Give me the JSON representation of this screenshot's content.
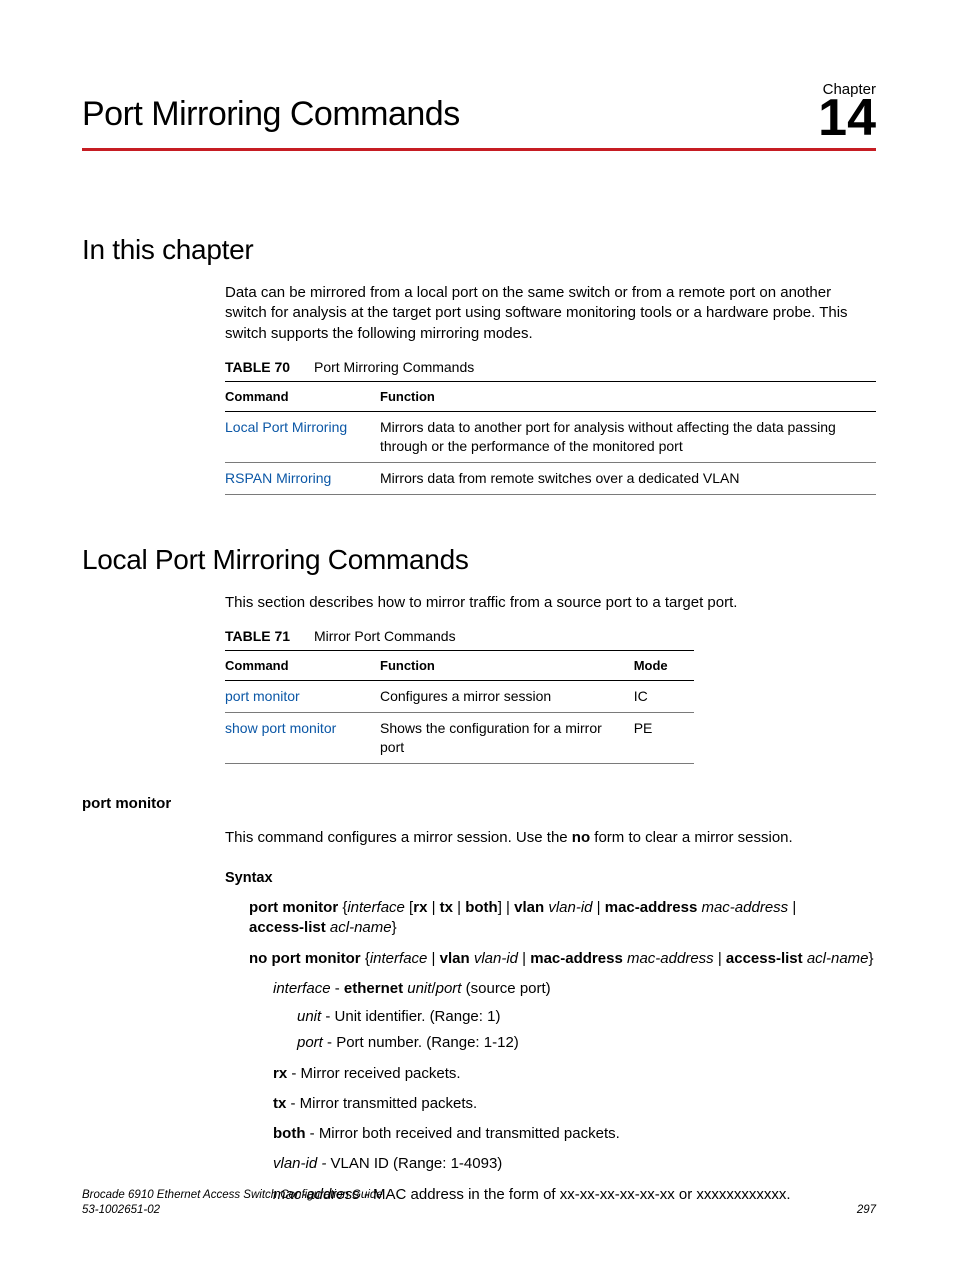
{
  "chapter": {
    "label": "Chapter",
    "number": "14",
    "title": "Port Mirroring Commands"
  },
  "s1": {
    "heading": "In this chapter",
    "intro": "Data can be mirrored from a local port on the same switch or from a remote port on another switch for analysis at the target port using software monitoring tools or a hardware probe. This switch supports the following mirroring modes.",
    "table70": {
      "num": "TABLE 70",
      "caption": "Port Mirroring Commands",
      "h1": "Command",
      "h2": "Function",
      "r1c1": "Local Port Mirroring",
      "r1c2": "Mirrors data to another port for analysis without affecting the data passing through or the performance of the monitored port",
      "r2c1": "RSPAN Mirroring",
      "r2c2": "Mirrors data from remote switches over a dedicated VLAN"
    }
  },
  "s2": {
    "heading": "Local Port Mirroring Commands",
    "intro": "This section describes how to mirror traffic from a source port to a target port.",
    "table71": {
      "num": "TABLE 71",
      "caption": "Mirror Port Commands",
      "h1": "Command",
      "h2": "Function",
      "h3": "Mode",
      "r1c1": "port monitor",
      "r1c2": "Configures a mirror session",
      "r1c3": "IC",
      "r2c1": "show port monitor",
      "r2c2": "Shows the configuration for a mirror port",
      "r2c3": "PE"
    }
  },
  "cmd": {
    "name": "port monitor",
    "desc_pre": "This command configures a mirror session. Use the ",
    "desc_bold": "no",
    "desc_post": " form to clear a mirror session.",
    "syntax_label": "Syntax",
    "syn1": {
      "p1": "port monitor",
      "p2": " {",
      "p3": "interface",
      "p4": " [",
      "p5": "rx",
      "p6": " | ",
      "p7": "tx",
      "p8": " | ",
      "p9": "both",
      "p10": "] | ",
      "p11": "vlan",
      "p12": " ",
      "p13": "vlan-id",
      "p14": " | ",
      "p15": "mac-address",
      "p16": " ",
      "p17": "mac-address",
      "p18": " | ",
      "p19": "access-list",
      "p20": " ",
      "p21": "acl-name",
      "p22": "}"
    },
    "syn2": {
      "p1": "no port monitor",
      "p2": " {",
      "p3": "interface",
      "p4": " | ",
      "p5": "vlan",
      "p6": " ",
      "p7": "vlan-id",
      "p8": " | ",
      "p9": "mac-address",
      "p10": " ",
      "p11": "mac-address",
      "p12": " | ",
      "p13": "access-list",
      "p14": " ",
      "p15": "acl-name",
      "p16": "}"
    },
    "par_interface": {
      "a": "interface",
      "b": " - ",
      "c": "ethernet",
      "d": " ",
      "e": "unit",
      "f": "/",
      "g": "port",
      "h": " (source port)"
    },
    "par_unit": {
      "a": "unit",
      "b": " - Unit identifier. (Range: 1)"
    },
    "par_port": {
      "a": "port",
      "b": " - Port number. (Range: 1-12)"
    },
    "par_rx": {
      "a": "rx",
      "b": " - Mirror received packets."
    },
    "par_tx": {
      "a": "tx",
      "b": " - Mirror transmitted packets."
    },
    "par_both": {
      "a": "both",
      "b": " - Mirror both received and transmitted packets."
    },
    "par_vlan": {
      "a": "vlan-id - ",
      "b": "VLAN ID (Range: 1-4093)"
    },
    "par_mac": {
      "a": "mac-address - ",
      "b": "MAC address in the form of xx-xx-xx-xx-xx-xx or xxxxxxxxxxxx."
    }
  },
  "footer": {
    "line1": "Brocade 6910 Ethernet Access Switch Configuration Guide",
    "line2": "53-1002651-02",
    "page": "297"
  }
}
